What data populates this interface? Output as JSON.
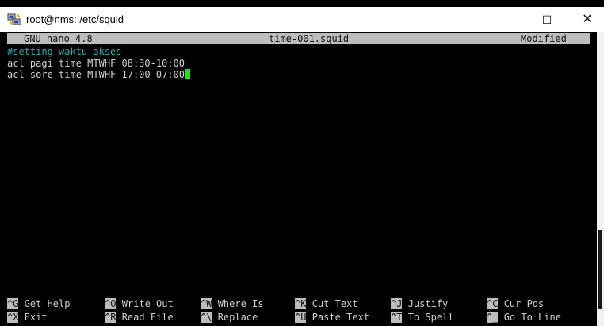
{
  "window": {
    "title": "root@nms: /etc/squid",
    "controls": {
      "minimize": "—",
      "maximize": "☐",
      "close": "✕"
    }
  },
  "nano": {
    "version_label": "GNU nano 4.8",
    "filename": "time-001.squid",
    "status": "Modified"
  },
  "file_lines": [
    "#setting waktu akses",
    "acl pagi time MTWHF 08:30-10:00",
    "acl sore time MTWHF 17:00-07:00"
  ],
  "shortcuts": {
    "row1": [
      {
        "key": "^G",
        "label": "Get Help"
      },
      {
        "key": "^O",
        "label": "Write Out"
      },
      {
        "key": "^W",
        "label": "Where Is"
      },
      {
        "key": "^K",
        "label": "Cut Text"
      },
      {
        "key": "^J",
        "label": "Justify"
      },
      {
        "key": "^C",
        "label": "Cur Pos"
      }
    ],
    "row2": [
      {
        "key": "^X",
        "label": "Exit"
      },
      {
        "key": "^R",
        "label": "Read File"
      },
      {
        "key": "^\\",
        "label": "Replace"
      },
      {
        "key": "^U",
        "label": "Paste Text"
      },
      {
        "key": "^T",
        "label": "To Spell"
      },
      {
        "key": "^_",
        "label": "Go To Line"
      }
    ]
  },
  "colors": {
    "terminal_bg": "#000000",
    "text": "#cfcfcf",
    "comment": "#1fb0b0",
    "cursor": "#1ee01e",
    "header_bg": "#bdbdbd"
  },
  "icons": {
    "app": "putty-icon"
  }
}
